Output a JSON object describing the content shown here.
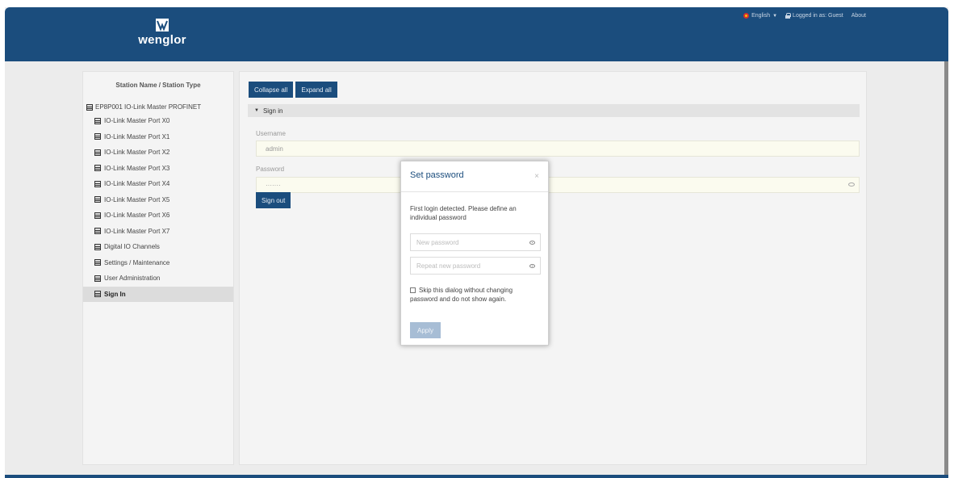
{
  "header": {
    "logo_text": "wenglor",
    "language": "English",
    "logged_in": "Logged in as: Guest",
    "about": "About"
  },
  "sidebar": {
    "title": "Station Name / Station Type",
    "root": "EP8P001 IO-Link Master PROFINET",
    "items": [
      {
        "label": "IO-Link Master Port X0"
      },
      {
        "label": "IO-Link Master Port X1"
      },
      {
        "label": "IO-Link Master Port X2"
      },
      {
        "label": "IO-Link Master Port X3"
      },
      {
        "label": "IO-Link Master Port X4"
      },
      {
        "label": "IO-Link Master Port X5"
      },
      {
        "label": "IO-Link Master Port X6"
      },
      {
        "label": "IO-Link Master Port X7"
      },
      {
        "label": "Digital IO Channels"
      },
      {
        "label": "Settings / Maintenance"
      },
      {
        "label": "User Administration"
      },
      {
        "label": "Sign In"
      }
    ]
  },
  "main": {
    "collapse_all": "Collapse all",
    "expand_all": "Expand all",
    "section_title": "Sign in",
    "username_label": "Username",
    "username_value": "admin",
    "password_label": "Password",
    "password_value": "·······",
    "sign_out": "Sign out"
  },
  "modal": {
    "title": "Set password",
    "close": "×",
    "message": "First login detected. Please define an individual password",
    "new_password_placeholder": "New password",
    "repeat_password_placeholder": "Repeat new password",
    "skip_text": "Skip this dialog without changing password and do not show again.",
    "apply": "Apply"
  }
}
